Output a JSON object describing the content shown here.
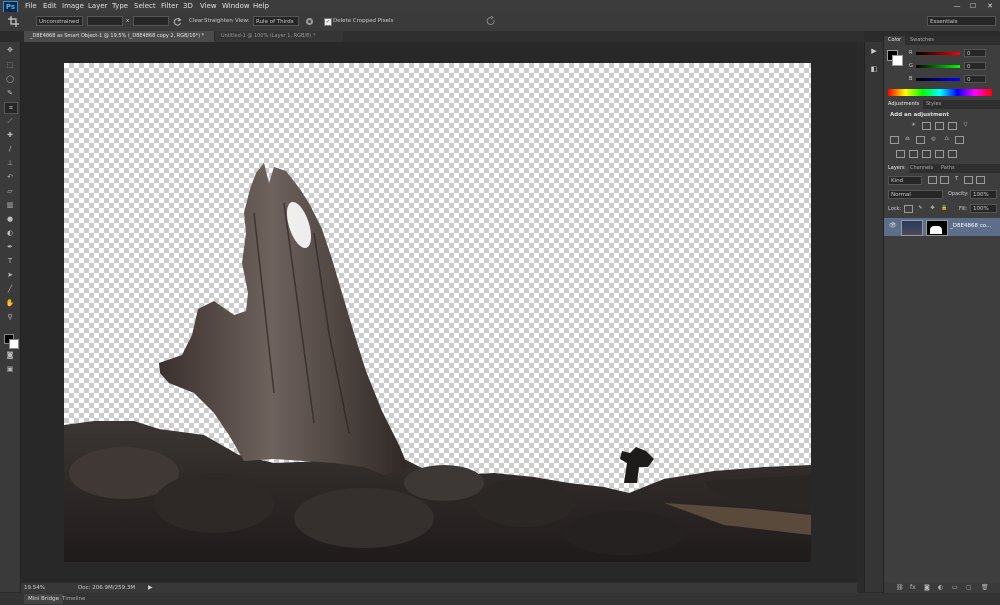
{
  "app": {
    "logo": "Ps"
  },
  "menu": [
    "File",
    "Edit",
    "Image",
    "Layer",
    "Type",
    "Select",
    "Filter",
    "3D",
    "View",
    "Window",
    "Help"
  ],
  "window_controls": {
    "minimize": "—",
    "maximize": "☐",
    "close": "✕"
  },
  "options_bar": {
    "ratio_select": "Unconstrained",
    "x_label": "x",
    "clear_label": "Clear",
    "straighten_label": "Straighten",
    "view_label": "View:",
    "view_select": "Rule of Thirds",
    "delete_cropped_label": "Delete Cropped Pixels",
    "delete_cropped_checked": true,
    "workspace_select": "Essentials"
  },
  "tabs": [
    {
      "label": "_D8E4868 as Smart Object-1 @ 19.5% (_D8E4868 copy 2, RGB/16*) *",
      "active": true
    },
    {
      "label": "Untitled-1 @ 100% (Layer 1, RGB/8) *",
      "active": false
    }
  ],
  "status": {
    "zoom": "19.54%",
    "doc": "Doc: 206.9M/259.3M"
  },
  "bottom_tabs": [
    "Mini Bridge",
    "Timeline"
  ],
  "color_panel": {
    "tabs": [
      "Color",
      "Swatches"
    ],
    "channels": [
      {
        "name": "R",
        "value": "0",
        "color": "#d33"
      },
      {
        "name": "G",
        "value": "0",
        "color": "#3b3"
      },
      {
        "name": "B",
        "value": "0",
        "color": "#35d"
      }
    ]
  },
  "adjustments_panel": {
    "tabs": [
      "Adjustments",
      "Styles"
    ],
    "title": "Add an adjustment"
  },
  "layers_panel": {
    "tabs": [
      "Layers",
      "Channels",
      "Paths"
    ],
    "kind_select": "Kind",
    "blend_mode": "Normal",
    "opacity_label": "Opacity:",
    "opacity_value": "100%",
    "lock_label": "Lock:",
    "fill_label": "Fill:",
    "fill_value": "100%",
    "layers": [
      {
        "name": "_D8E4868 co..."
      }
    ]
  },
  "colors": {
    "accent": "#3f8ed7",
    "panel": "#3e3e3e",
    "selection": "#5c6e89"
  }
}
